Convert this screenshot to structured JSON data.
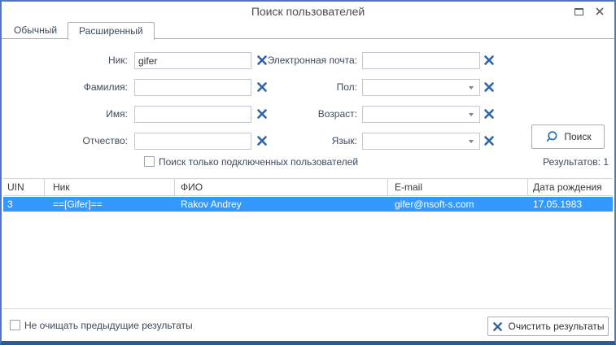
{
  "window": {
    "title": "Поиск пользователей"
  },
  "tabs": {
    "normal": "Обычный",
    "advanced": "Расширенный"
  },
  "form": {
    "nick": {
      "label": "Ник:",
      "value": "gifer"
    },
    "lastname": {
      "label": "Фамилия:",
      "value": ""
    },
    "firstname": {
      "label": "Имя:",
      "value": ""
    },
    "middlename": {
      "label": "Отчество:",
      "value": ""
    },
    "email": {
      "label": "Электронная почта:",
      "value": ""
    },
    "gender": {
      "label": "Пол:",
      "value": ""
    },
    "age": {
      "label": "Возраст:",
      "value": ""
    },
    "language": {
      "label": "Язык:",
      "value": ""
    },
    "search_button": "Поиск",
    "online_only_label": "Поиск только подключенных пользователей",
    "results_count": "Результатов: 1"
  },
  "table": {
    "columns": [
      "UIN",
      "Ник",
      "ФИО",
      "E-mail",
      "Дата рождения"
    ],
    "rows": [
      {
        "selected": true,
        "cells": [
          "3",
          "==[Gifer]==",
          "Rakov Andrey",
          "gifer@nsoft-s.com",
          "17.05.1983"
        ]
      }
    ]
  },
  "footer": {
    "keep_results_label": "Не очищать предыдущие результаты",
    "clear_button": "Очистить результаты"
  },
  "colors": {
    "window_border": "#4b79c5",
    "window_border_bottom": "#2e5a94",
    "selection_blue": "#3399fe",
    "accent_icon_blue": "#2f63a7"
  }
}
